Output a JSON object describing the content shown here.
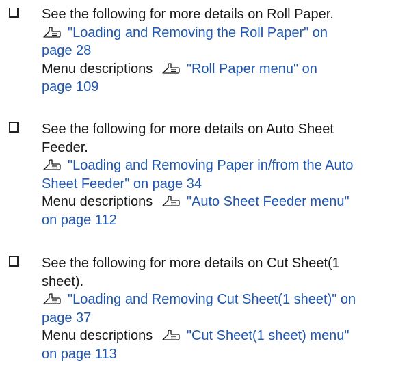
{
  "bullets": [
    {
      "intro_lines": [
        "See the following for more details on Roll Paper."
      ],
      "ref_icon": "pointing-hand-reference-icon",
      "ref_link_lines": [
        "\"Loading and Removing the Roll Paper\" on",
        "page 28"
      ],
      "menu_label": "Menu descriptions",
      "menu_icon": "pointing-hand-reference-icon",
      "menu_link_lines": [
        "\"Roll Paper menu\" on",
        "page 109"
      ]
    },
    {
      "intro_lines": [
        "See the following for more details on Auto Sheet",
        "Feeder."
      ],
      "ref_icon": "pointing-hand-reference-icon",
      "ref_link_lines": [
        "\"Loading and Removing Paper in/from the Auto",
        "Sheet Feeder\" on page 34"
      ],
      "menu_label": "Menu descriptions",
      "menu_icon": "pointing-hand-reference-icon",
      "menu_link_lines": [
        "\"Auto Sheet Feeder menu\"",
        "on page 112"
      ]
    },
    {
      "intro_lines": [
        "See the following for more details on Cut Sheet(1",
        "sheet)."
      ],
      "ref_icon": "pointing-hand-reference-icon",
      "ref_link_lines": [
        "\"Loading and Removing Cut Sheet(1 sheet)\" on",
        "page 37"
      ],
      "menu_label": "Menu descriptions",
      "menu_icon": "pointing-hand-reference-icon",
      "menu_link_lines": [
        "\"Cut Sheet(1 sheet) menu\"",
        "on page 113"
      ]
    }
  ],
  "colors": {
    "link": "#1f57b0",
    "text": "#1a1a1a"
  }
}
